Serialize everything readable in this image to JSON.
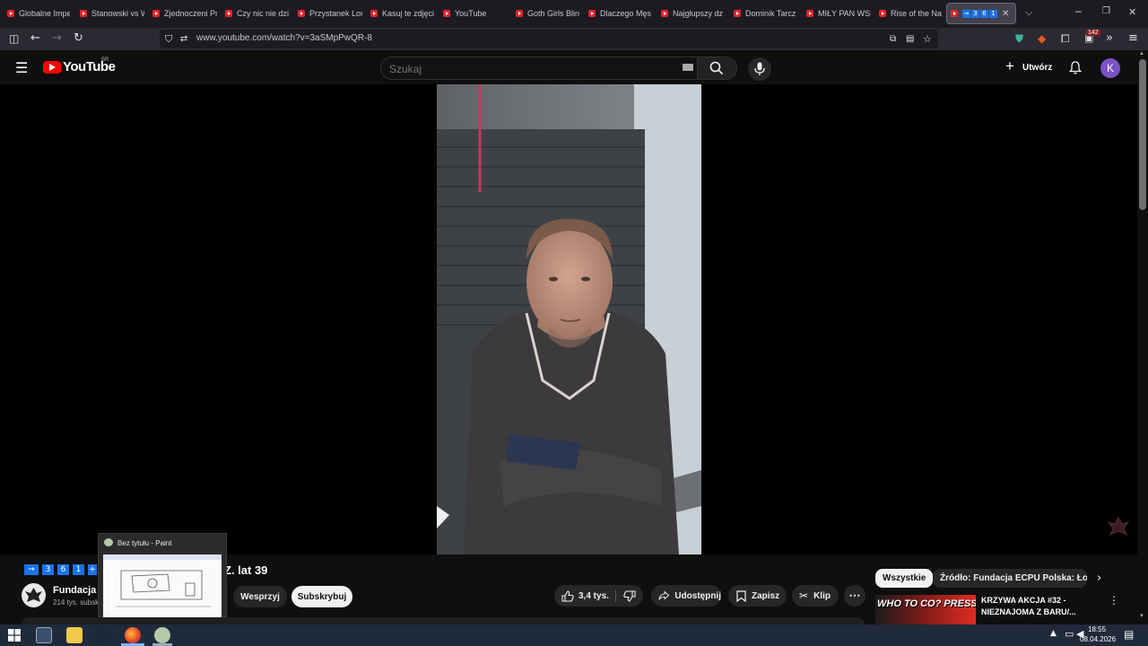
{
  "browser": {
    "tabs": [
      {
        "title": "Globalne Impe"
      },
      {
        "title": "Stanowski vs W"
      },
      {
        "title": "Zjednoczeni Pr"
      },
      {
        "title": "Czy nic nie dzi"
      },
      {
        "title": "Przystanek Lon"
      },
      {
        "title": "Kasuj te zdjęci"
      },
      {
        "title": "YouTube"
      },
      {
        "title": "Goth Girls Blin"
      },
      {
        "title": "Dlaczego Męs"
      },
      {
        "title": "Najgłupszy dz"
      },
      {
        "title": "Dominik Tarcz"
      },
      {
        "title": "MIŁY PAN WSP"
      },
      {
        "title": "Rise of the Na"
      }
    ],
    "active_tab": {
      "digits": [
        "3",
        "6",
        "1"
      ]
    },
    "url": "www.youtube.com/watch?v=3aSMpPwQR-8",
    "extension_badge": "142"
  },
  "youtube": {
    "logo_text": "YouTube",
    "region": "BR",
    "search_placeholder": "Szukaj",
    "create_label": "Utwórz",
    "avatar_letter": "K",
    "accent": "#ff0000",
    "avatar_color": "#7b52c7"
  },
  "video": {
    "title_badges": [
      "3",
      "6",
      "1"
    ],
    "title_text": "Z. lat 39",
    "channel_name": "Fundacja E",
    "subscribers": "214 tys. subsk",
    "support_label": "Wesprzyj",
    "subscribe_label": "Subskrybuj",
    "likes": "3,4 tys.",
    "share_label": "Udostępnij",
    "save_label": "Zapisz",
    "clip_label": "Klip"
  },
  "recommendations": {
    "chips": [
      "Wszystkie",
      "Źródło: Fundacja ECPU Polska: Łowcy"
    ],
    "first_item": {
      "thumb_text": "WHO TO CO? PRESSING!",
      "title_line1": "KRZYWA AKCJA #32 -",
      "title_line2": "NIEZNAJOMA Z BARU/..."
    }
  },
  "taskbar_popup": {
    "title": "Bez tytułu - Paint"
  },
  "taskbar": {
    "time": "18:55",
    "date": "08.04.2026"
  }
}
